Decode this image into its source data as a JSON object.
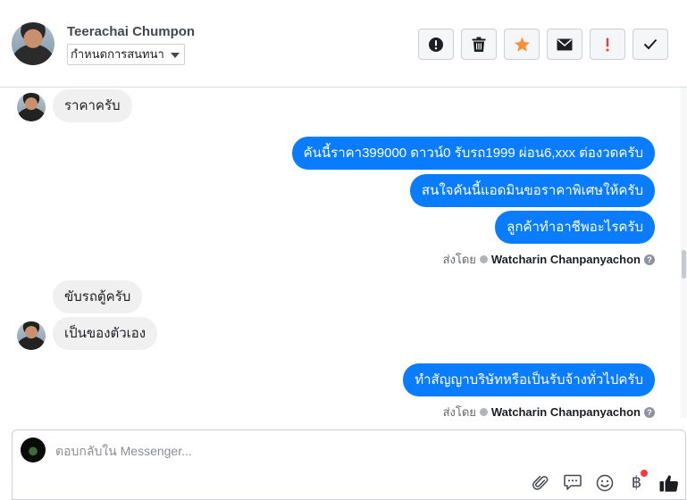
{
  "header": {
    "contact_name": "Teerachai Chumpon",
    "conversation_select": "กำหนดการสนทนา",
    "actions": [
      {
        "icon": "alert-circle-icon",
        "color": "#1c1e21"
      },
      {
        "icon": "trash-icon",
        "color": "#1c1e21"
      },
      {
        "icon": "star-icon",
        "color": "#f7923a"
      },
      {
        "icon": "envelope-icon",
        "color": "#1c1e21"
      },
      {
        "icon": "exclamation-icon",
        "color": "#fa383e"
      },
      {
        "icon": "check-icon",
        "color": "#1c1e21"
      }
    ]
  },
  "messages": {
    "m1": "ราคาครับ",
    "m2": "คันนี้ราคา399000 ดาวน์0   รับรถ1999 ผ่อน6,xxx ต่องวดครับ",
    "m3": "สนใจคันนี้แอดมินขอราคาพิเศษให้ครับ",
    "m4": "ลูกค้าทำอาชีพอะไรครับ",
    "m5": "ขับรถตู้ครับ",
    "m6": "เป็นของตัวเอง",
    "m7": "ทำสัญญาบริษัทหรือเป็นรับจ้างทั่วไปครับ"
  },
  "sent_by": {
    "label": "ส่งโดย",
    "name": "Watcharin Chanpanyachon",
    "help": "?"
  },
  "composer": {
    "placeholder": "ตอบกลับใน Messenger...",
    "currency_symbol": "฿"
  },
  "colors": {
    "outgoing_bubble": "#0a7cff",
    "incoming_bubble": "#f1f0f0",
    "star": "#f7923a",
    "alert_red": "#fa383e"
  }
}
